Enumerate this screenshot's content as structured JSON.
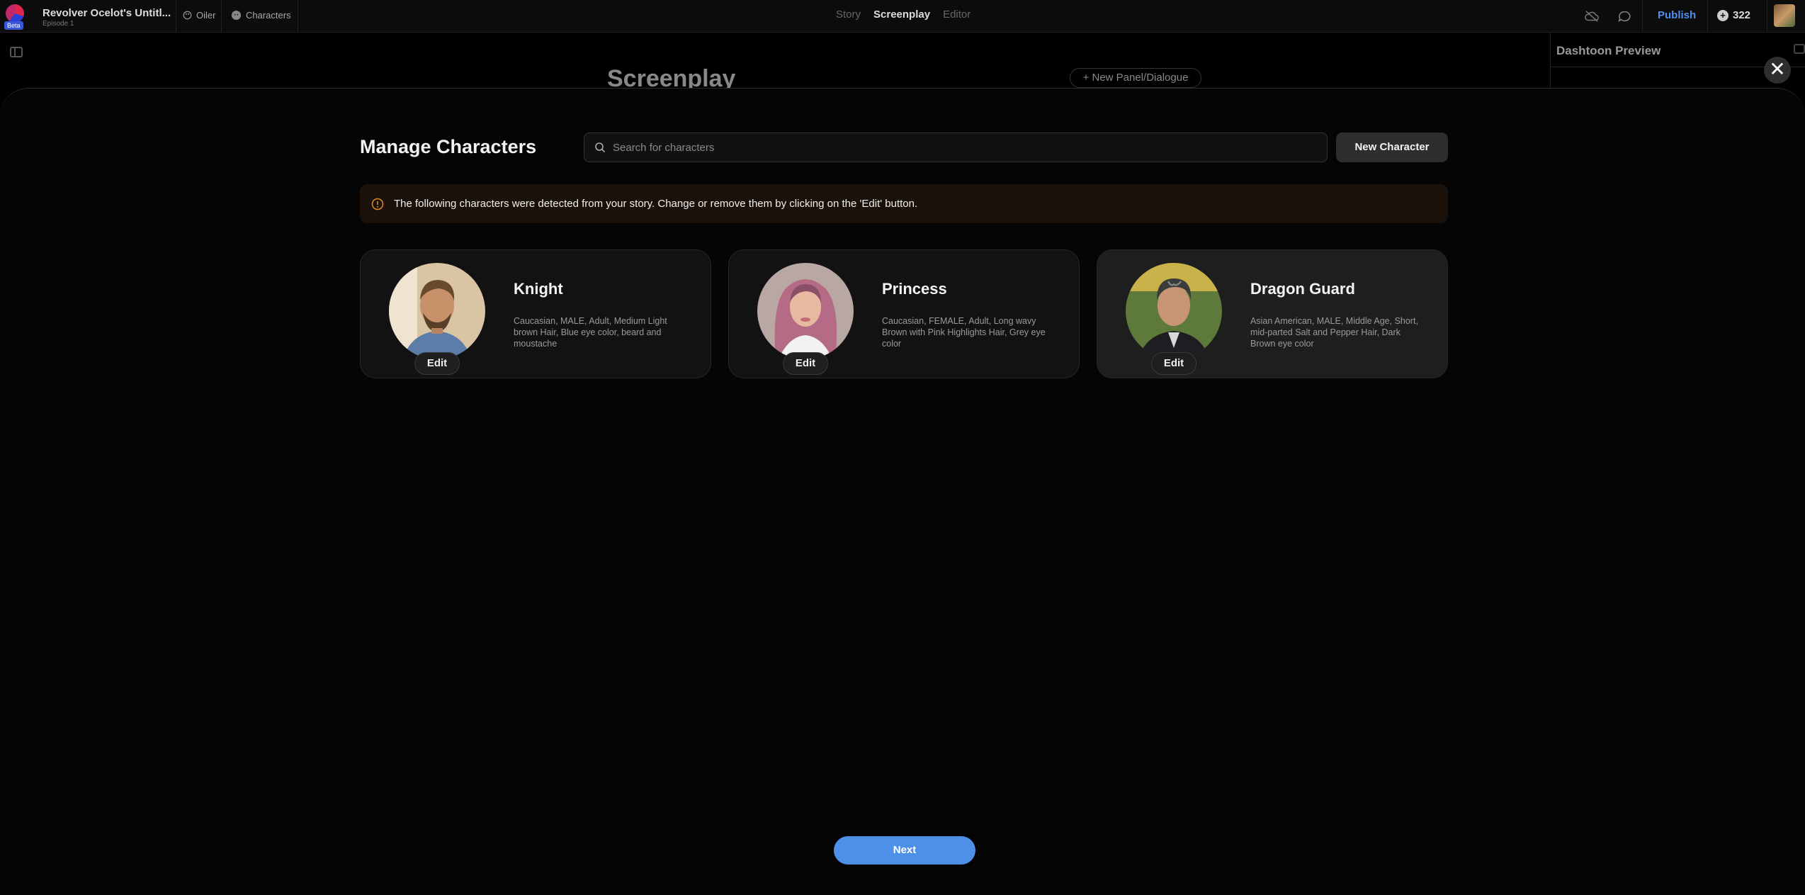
{
  "topbar": {
    "beta_label": "Beta",
    "project_title": "Revolver Ocelot's Untitl...",
    "episode": "Episode 1",
    "chip_oiler": "Oiler",
    "chip_characters": "Characters",
    "tabs": [
      "Story",
      "Screenplay",
      "Editor"
    ],
    "active_tab": "Screenplay",
    "publish": "Publish",
    "credits": "322"
  },
  "background": {
    "heading": "Screenplay",
    "new_panel": "+ New Panel/Dialogue",
    "right_panel_title": "Dashtoon Preview"
  },
  "modal": {
    "title": "Manage Characters",
    "search_placeholder": "Search for characters",
    "new_character": "New Character",
    "notice": "The following characters were detected from your story. Change or remove them by clicking on the 'Edit' button.",
    "edit_label": "Edit",
    "next": "Next",
    "close": "✕",
    "characters": [
      {
        "name": "Knight",
        "description": "Caucasian, MALE, Adult, Medium Light brown Hair, Blue eye color, beard and moustache"
      },
      {
        "name": "Princess",
        "description": "Caucasian, FEMALE, Adult, Long wavy Brown with Pink Highlights Hair, Grey eye color"
      },
      {
        "name": "Dragon Guard",
        "description": "Asian American, MALE, Middle Age, Short, mid-parted Salt and Pepper Hair, Dark Brown eye color"
      }
    ]
  },
  "colors": {
    "accent": "#4d90e8",
    "notice_bg": "#1a120a",
    "notice_icon": "#e08a2a"
  }
}
